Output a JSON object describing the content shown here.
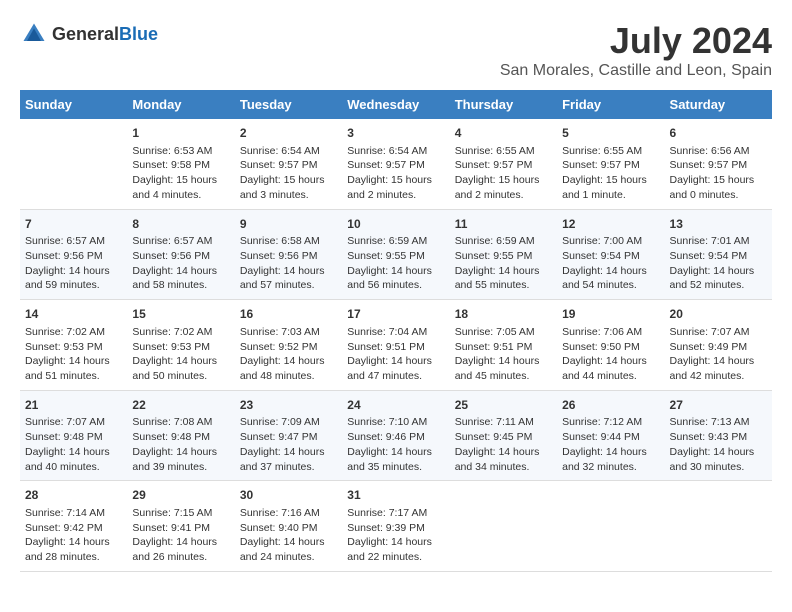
{
  "header": {
    "logo_general": "General",
    "logo_blue": "Blue",
    "month_year": "July 2024",
    "location": "San Morales, Castille and Leon, Spain"
  },
  "calendar": {
    "days_of_week": [
      "Sunday",
      "Monday",
      "Tuesday",
      "Wednesday",
      "Thursday",
      "Friday",
      "Saturday"
    ],
    "weeks": [
      [
        {
          "day": "",
          "info": ""
        },
        {
          "day": "1",
          "info": "Sunrise: 6:53 AM\nSunset: 9:58 PM\nDaylight: 15 hours\nand 4 minutes."
        },
        {
          "day": "2",
          "info": "Sunrise: 6:54 AM\nSunset: 9:57 PM\nDaylight: 15 hours\nand 3 minutes."
        },
        {
          "day": "3",
          "info": "Sunrise: 6:54 AM\nSunset: 9:57 PM\nDaylight: 15 hours\nand 2 minutes."
        },
        {
          "day": "4",
          "info": "Sunrise: 6:55 AM\nSunset: 9:57 PM\nDaylight: 15 hours\nand 2 minutes."
        },
        {
          "day": "5",
          "info": "Sunrise: 6:55 AM\nSunset: 9:57 PM\nDaylight: 15 hours\nand 1 minute."
        },
        {
          "day": "6",
          "info": "Sunrise: 6:56 AM\nSunset: 9:57 PM\nDaylight: 15 hours\nand 0 minutes."
        }
      ],
      [
        {
          "day": "7",
          "info": "Sunrise: 6:57 AM\nSunset: 9:56 PM\nDaylight: 14 hours\nand 59 minutes."
        },
        {
          "day": "8",
          "info": "Sunrise: 6:57 AM\nSunset: 9:56 PM\nDaylight: 14 hours\nand 58 minutes."
        },
        {
          "day": "9",
          "info": "Sunrise: 6:58 AM\nSunset: 9:56 PM\nDaylight: 14 hours\nand 57 minutes."
        },
        {
          "day": "10",
          "info": "Sunrise: 6:59 AM\nSunset: 9:55 PM\nDaylight: 14 hours\nand 56 minutes."
        },
        {
          "day": "11",
          "info": "Sunrise: 6:59 AM\nSunset: 9:55 PM\nDaylight: 14 hours\nand 55 minutes."
        },
        {
          "day": "12",
          "info": "Sunrise: 7:00 AM\nSunset: 9:54 PM\nDaylight: 14 hours\nand 54 minutes."
        },
        {
          "day": "13",
          "info": "Sunrise: 7:01 AM\nSunset: 9:54 PM\nDaylight: 14 hours\nand 52 minutes."
        }
      ],
      [
        {
          "day": "14",
          "info": "Sunrise: 7:02 AM\nSunset: 9:53 PM\nDaylight: 14 hours\nand 51 minutes."
        },
        {
          "day": "15",
          "info": "Sunrise: 7:02 AM\nSunset: 9:53 PM\nDaylight: 14 hours\nand 50 minutes."
        },
        {
          "day": "16",
          "info": "Sunrise: 7:03 AM\nSunset: 9:52 PM\nDaylight: 14 hours\nand 48 minutes."
        },
        {
          "day": "17",
          "info": "Sunrise: 7:04 AM\nSunset: 9:51 PM\nDaylight: 14 hours\nand 47 minutes."
        },
        {
          "day": "18",
          "info": "Sunrise: 7:05 AM\nSunset: 9:51 PM\nDaylight: 14 hours\nand 45 minutes."
        },
        {
          "day": "19",
          "info": "Sunrise: 7:06 AM\nSunset: 9:50 PM\nDaylight: 14 hours\nand 44 minutes."
        },
        {
          "day": "20",
          "info": "Sunrise: 7:07 AM\nSunset: 9:49 PM\nDaylight: 14 hours\nand 42 minutes."
        }
      ],
      [
        {
          "day": "21",
          "info": "Sunrise: 7:07 AM\nSunset: 9:48 PM\nDaylight: 14 hours\nand 40 minutes."
        },
        {
          "day": "22",
          "info": "Sunrise: 7:08 AM\nSunset: 9:48 PM\nDaylight: 14 hours\nand 39 minutes."
        },
        {
          "day": "23",
          "info": "Sunrise: 7:09 AM\nSunset: 9:47 PM\nDaylight: 14 hours\nand 37 minutes."
        },
        {
          "day": "24",
          "info": "Sunrise: 7:10 AM\nSunset: 9:46 PM\nDaylight: 14 hours\nand 35 minutes."
        },
        {
          "day": "25",
          "info": "Sunrise: 7:11 AM\nSunset: 9:45 PM\nDaylight: 14 hours\nand 34 minutes."
        },
        {
          "day": "26",
          "info": "Sunrise: 7:12 AM\nSunset: 9:44 PM\nDaylight: 14 hours\nand 32 minutes."
        },
        {
          "day": "27",
          "info": "Sunrise: 7:13 AM\nSunset: 9:43 PM\nDaylight: 14 hours\nand 30 minutes."
        }
      ],
      [
        {
          "day": "28",
          "info": "Sunrise: 7:14 AM\nSunset: 9:42 PM\nDaylight: 14 hours\nand 28 minutes."
        },
        {
          "day": "29",
          "info": "Sunrise: 7:15 AM\nSunset: 9:41 PM\nDaylight: 14 hours\nand 26 minutes."
        },
        {
          "day": "30",
          "info": "Sunrise: 7:16 AM\nSunset: 9:40 PM\nDaylight: 14 hours\nand 24 minutes."
        },
        {
          "day": "31",
          "info": "Sunrise: 7:17 AM\nSunset: 9:39 PM\nDaylight: 14 hours\nand 22 minutes."
        },
        {
          "day": "",
          "info": ""
        },
        {
          "day": "",
          "info": ""
        },
        {
          "day": "",
          "info": ""
        }
      ]
    ]
  }
}
